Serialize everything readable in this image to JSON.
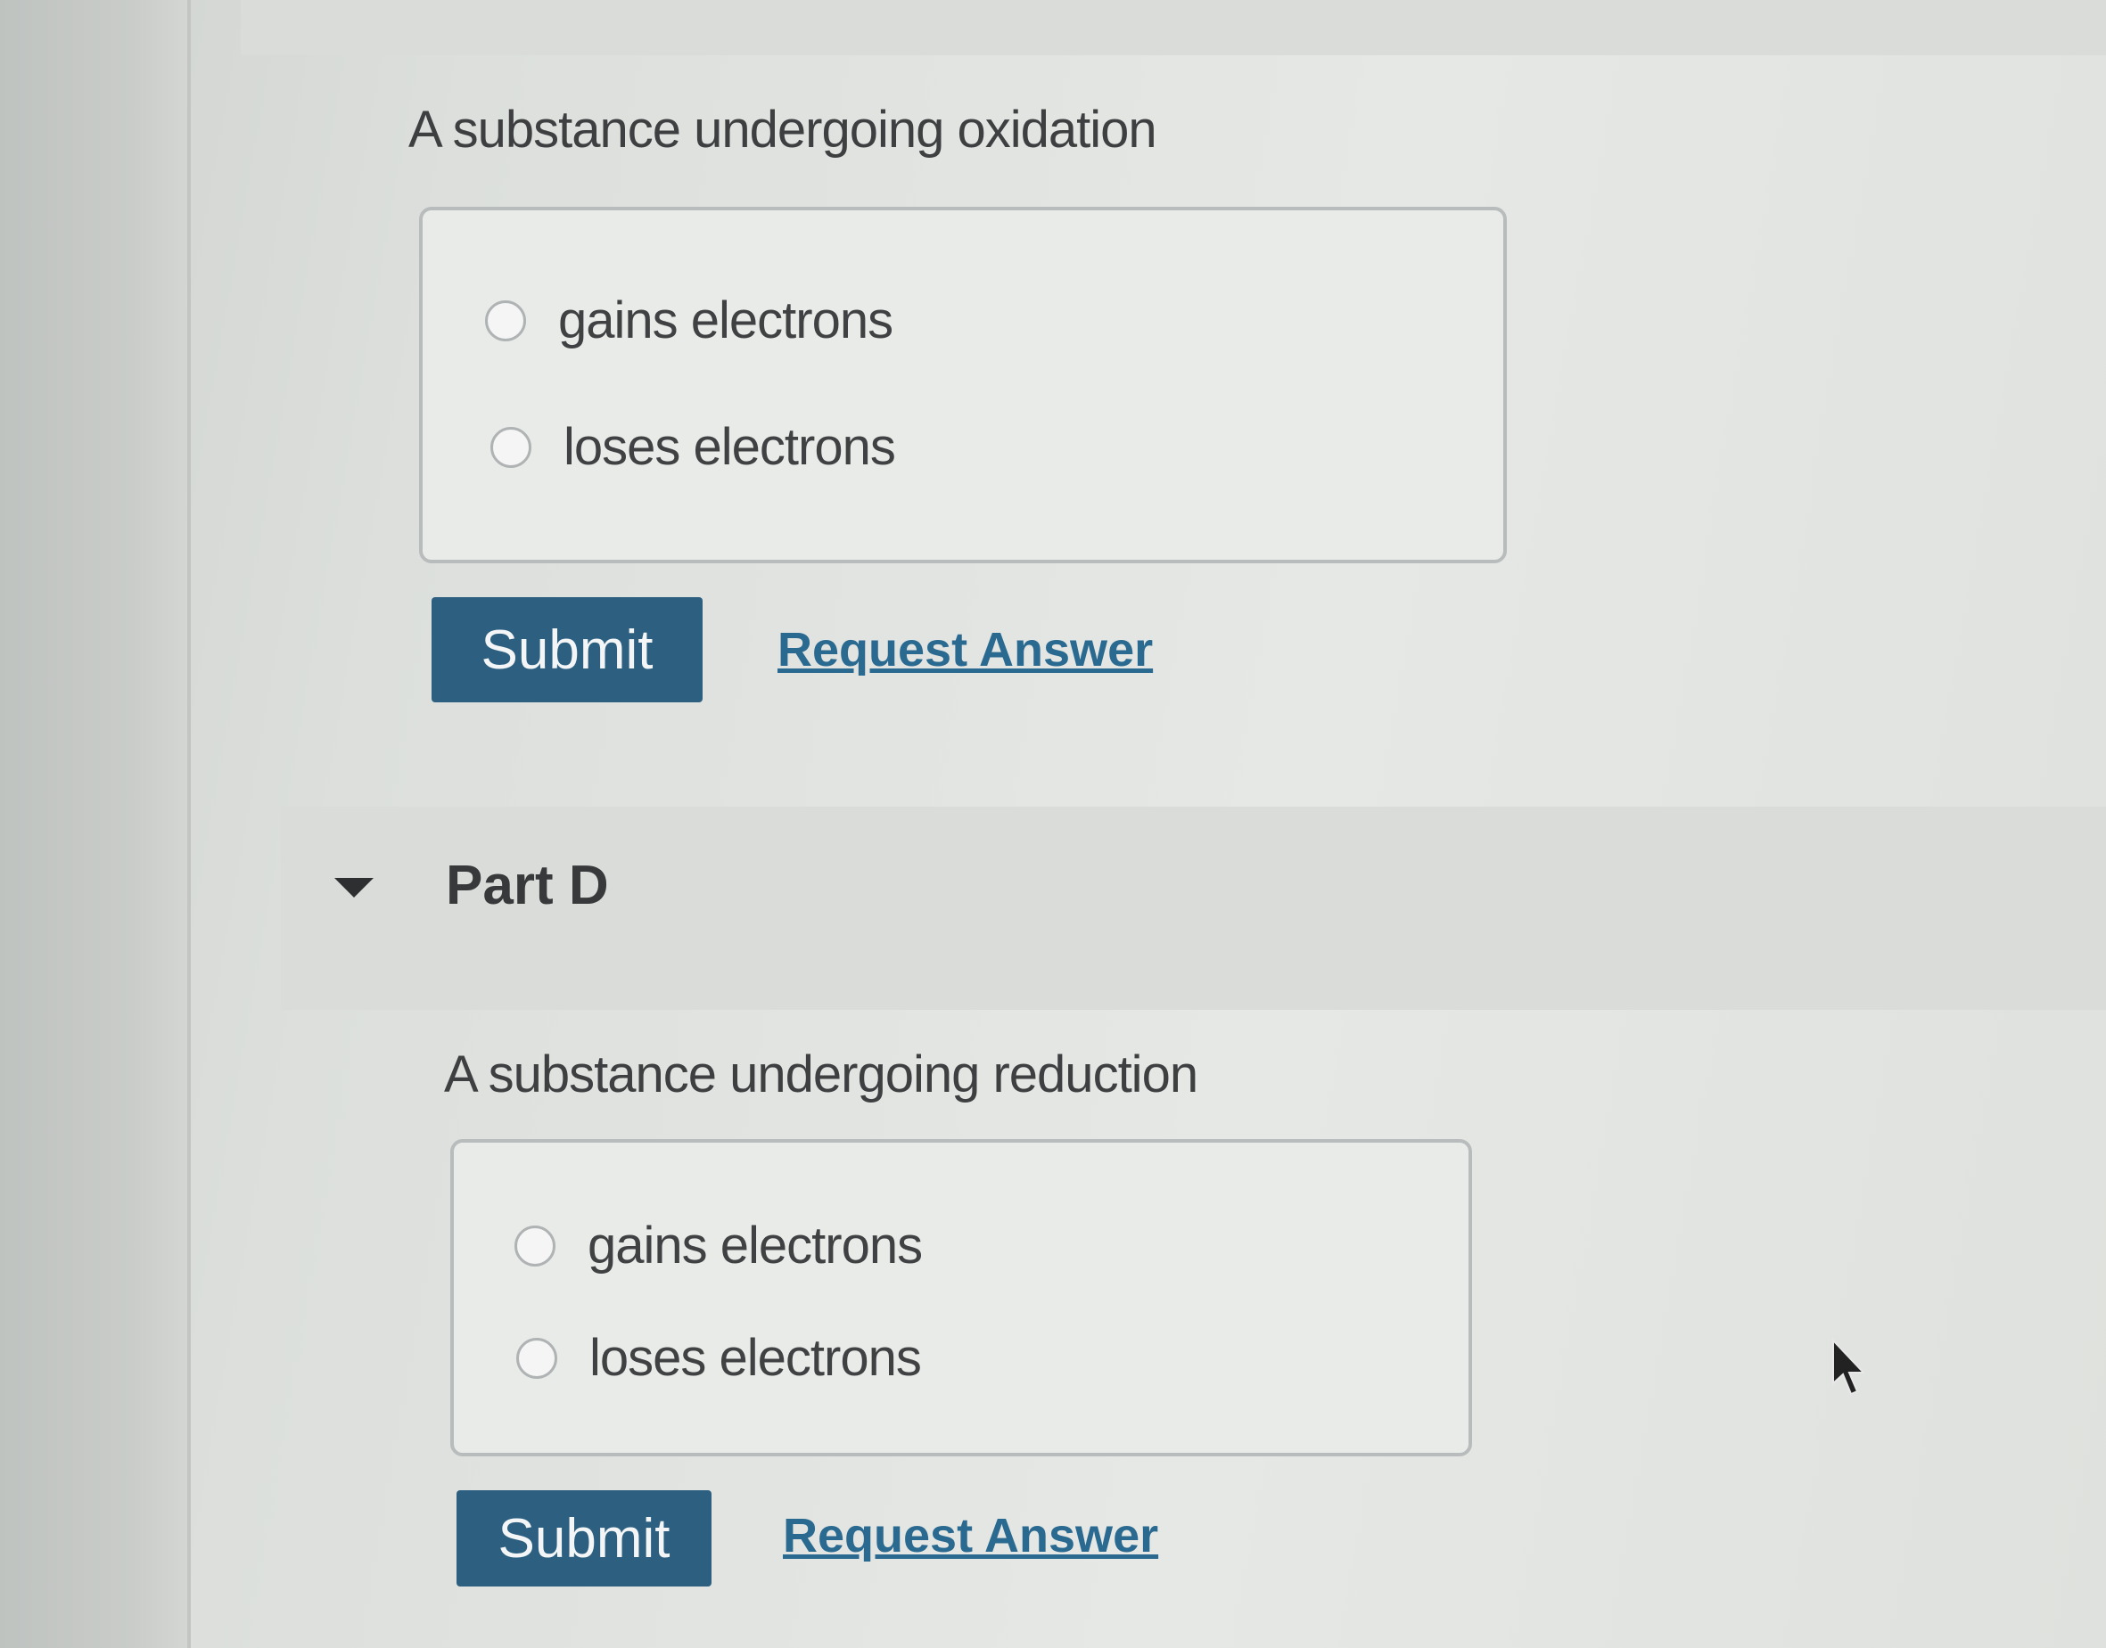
{
  "partC": {
    "question": "A substance undergoing oxidation",
    "choices": [
      "gains electrons",
      "loses electrons"
    ],
    "submit_label": "Submit",
    "request_label": "Request Answer"
  },
  "partD": {
    "title": "Part D",
    "question": "A substance undergoing reduction",
    "choices": [
      "gains electrons",
      "loses electrons"
    ],
    "submit_label": "Submit",
    "request_label": "Request Answer"
  },
  "colors": {
    "submit_bg": "#2c5f80",
    "link": "#2a6a90"
  },
  "icons": {
    "collapse": "caret-down-icon",
    "pointer": "mouse-pointer-icon"
  }
}
